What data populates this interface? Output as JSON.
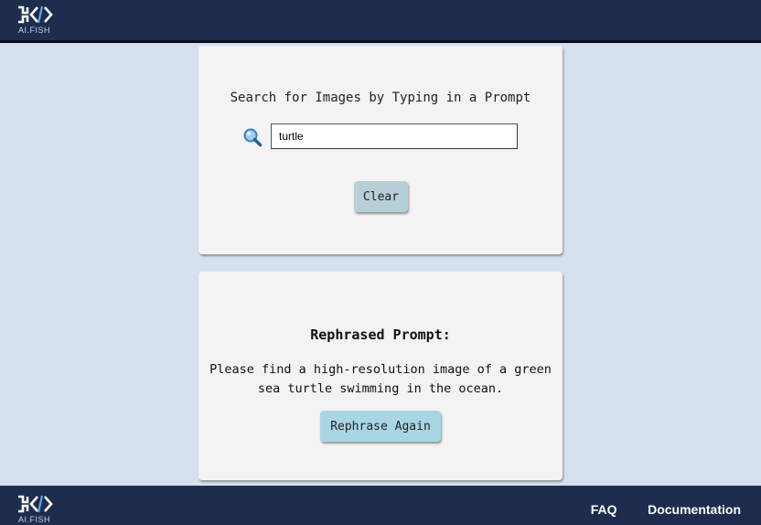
{
  "header": {
    "logo_text": "AI.FISH"
  },
  "search": {
    "title": "Search for Images by Typing in a Prompt",
    "icon": "magnifier-icon",
    "input_value": "turtle",
    "clear_label": "Clear"
  },
  "rephrase": {
    "heading": "Rephrased Prompt:",
    "text": "Please find a high-resolution image of a green sea turtle swimming in the ocean.",
    "button_label": "Rephrase Again"
  },
  "footer": {
    "logo_text": "AI.FISH",
    "links": [
      "FAQ",
      "Documentation"
    ]
  },
  "colors": {
    "nav_bg": "#1e2d4d",
    "page_bg": "#d5e1ee",
    "card_bg": "#f3f3f3",
    "clear_button": "#b7cfd8",
    "rephrase_button": "#a9d6e3"
  }
}
